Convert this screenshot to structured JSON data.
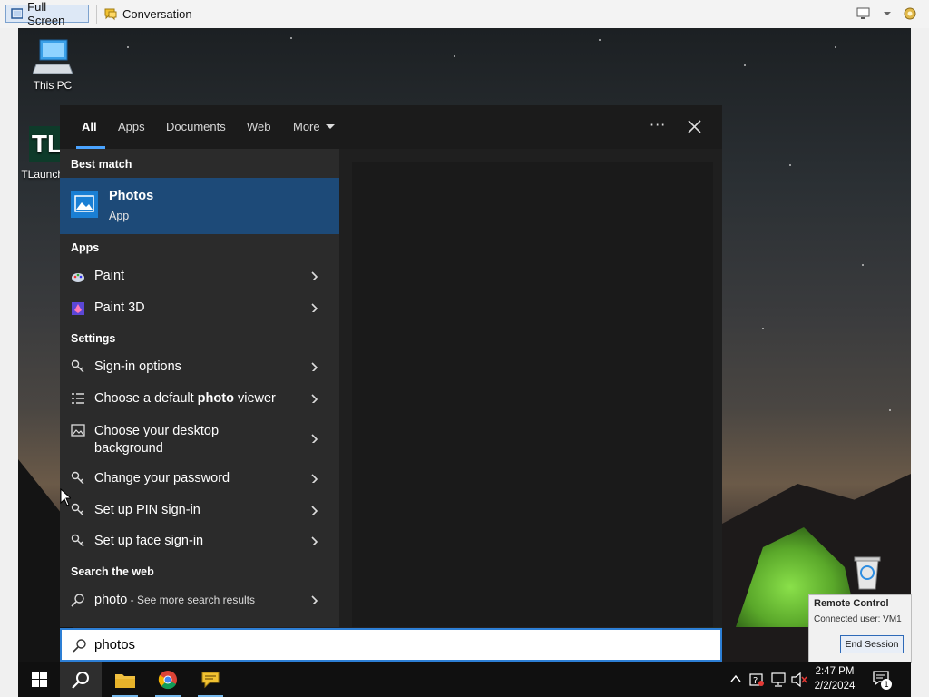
{
  "toolbar": {
    "fullscreen_label": "Full Screen",
    "conversation_label": "Conversation"
  },
  "desktop": {
    "icons": [
      {
        "label": "This PC"
      },
      {
        "label": "TLauncher"
      }
    ]
  },
  "search_panel": {
    "tabs": [
      {
        "label": "All",
        "active": true
      },
      {
        "label": "Apps"
      },
      {
        "label": "Documents"
      },
      {
        "label": "Web"
      },
      {
        "label": "More"
      }
    ],
    "more_options_label": "···",
    "best_match": {
      "heading": "Best match",
      "title": "Photos",
      "subtitle": "App"
    },
    "apps": {
      "heading": "Apps",
      "items": [
        {
          "label": "Paint"
        },
        {
          "label": "Paint 3D"
        }
      ]
    },
    "settings": {
      "heading": "Settings",
      "items": [
        {
          "label": "Sign-in options"
        },
        {
          "label_pre": "Choose a default ",
          "label_bold": "photo",
          "label_post": " viewer"
        },
        {
          "label_line1": "Choose your desktop",
          "label_line2": "background"
        },
        {
          "label": "Change your password"
        },
        {
          "label": "Set up PIN sign-in"
        },
        {
          "label": "Set up face sign-in"
        }
      ]
    },
    "web": {
      "heading": "Search the web",
      "query": "photo",
      "suffix": " - See more search results"
    },
    "search_value": "photos"
  },
  "remote_popup": {
    "title": "Remote Control",
    "status": "Connected user: VM1",
    "end_label": "End Session"
  },
  "taskbar": {
    "time": "2:47 PM",
    "date": "2/2/2024",
    "notification_count": "1"
  },
  "colors": {
    "accent": "#2d7fd5",
    "best_match_bg": "#1d4a78"
  }
}
